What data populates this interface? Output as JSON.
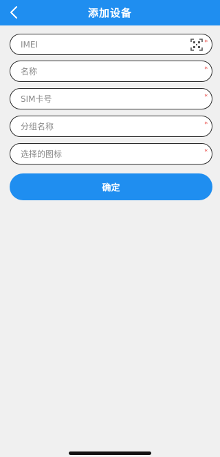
{
  "header": {
    "title": "添加设备",
    "back_icon": "chevron-left-icon",
    "background": "#1f8ef0"
  },
  "form": {
    "fields": [
      {
        "placeholder": "IMEI",
        "required_mark": "*",
        "trailing_icon": "qr-scan-icon"
      },
      {
        "placeholder": "名称",
        "required_mark": "*"
      },
      {
        "placeholder": "SIM卡号",
        "required_mark": "*"
      },
      {
        "placeholder": "分组名称",
        "required_mark": "*"
      },
      {
        "placeholder": "选择的图标",
        "required_mark": "*"
      }
    ]
  },
  "actions": {
    "confirm_label": "确定",
    "accent": "#1f8ef0"
  }
}
